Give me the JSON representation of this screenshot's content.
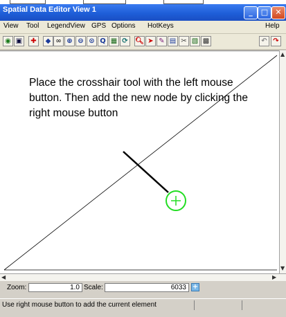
{
  "window": {
    "title": "Spatial Data Editor View 1",
    "minimize_glyph": "_",
    "maximize_glyph": "□",
    "close_glyph": "✕"
  },
  "menu": {
    "items": [
      "View",
      "Tool",
      "LegendView",
      "GPS",
      "Options",
      "HotKeys",
      "Help"
    ]
  },
  "toolbar": {
    "icons": [
      "new-view-icon",
      "layer-icon",
      "select-icon",
      "shape-icon",
      "binoculars-icon",
      "zoom-in-icon",
      "zoom-out-icon",
      "zoom-box-icon",
      "zoom-full-icon",
      "measure-icon",
      "redraw-icon",
      "search-icon",
      "pointer-icon",
      "edit-icon",
      "graph-icon",
      "cut-icon",
      "layer-manage-icon",
      "map-icon",
      "undo-icon",
      "redo-icon"
    ]
  },
  "canvas": {
    "instruction": "Place the crosshair tool with the left mouse button.  Then add the new node by clicking the right mouse button",
    "crosshair_color": "#22dd22",
    "pointer_color": "#000000"
  },
  "zoom": {
    "zoom_label": "Zoom:",
    "zoom_value": "1.0",
    "scale_label": "Scale:",
    "scale_value": "6033"
  },
  "status": {
    "message": "Use right mouse button to add the current element"
  },
  "colors": {
    "titlebar": "#1e5ed8",
    "chrome": "#d4d0c8"
  }
}
